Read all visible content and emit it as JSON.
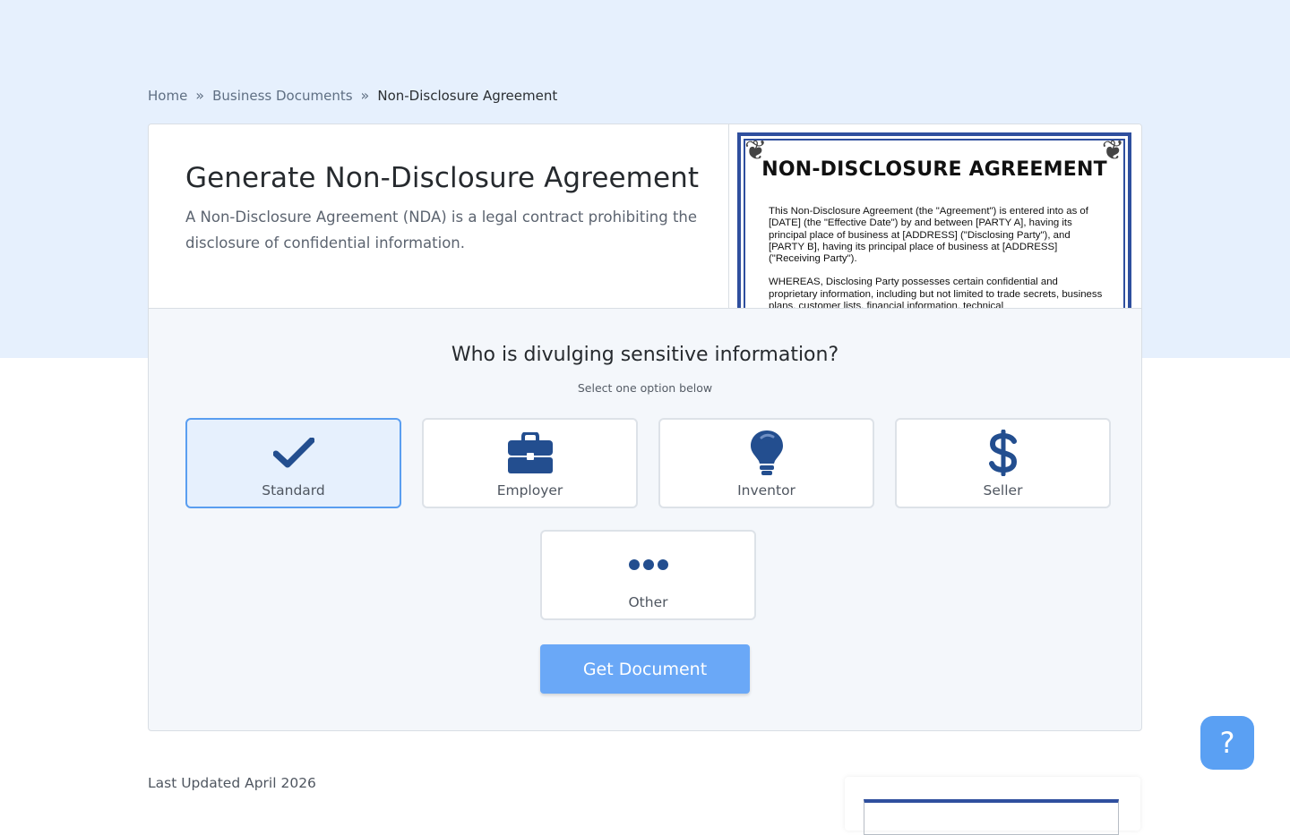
{
  "breadcrumb": {
    "items": [
      "Home",
      "Business Documents"
    ],
    "separator": "»",
    "current": "Non-Disclosure Agreement"
  },
  "intro": {
    "title": "Generate Non-Disclosure Agreement",
    "description": "A Non-Disclosure Agreement (NDA) is a legal contract prohibiting the disclosure of confidential information."
  },
  "preview": {
    "title": "NON-DISCLOSURE AGREEMENT",
    "paragraphs": [
      "This Non-Disclosure Agreement (the \"Agreement\") is entered into as of [DATE] (the \"Effective Date\") by and between [PARTY A], having its principal place of business at [ADDRESS] (\"Disclosing Party\"), and [PARTY B], having its principal place of business at [ADDRESS] (\"Receiving Party\").",
      "WHEREAS, Disclosing Party possesses certain confidential and proprietary information, including but not limited to trade secrets, business plans, customer lists, financial information, technical"
    ]
  },
  "form": {
    "question": "Who is divulging sensitive information?",
    "hint": "Select one option below",
    "options": [
      {
        "label": "Standard",
        "icon": "checkmark-icon",
        "selected": true
      },
      {
        "label": "Employer",
        "icon": "briefcase-icon",
        "selected": false
      },
      {
        "label": "Inventor",
        "icon": "lightbulb-icon",
        "selected": false
      },
      {
        "label": "Seller",
        "icon": "dollar-icon",
        "selected": false
      },
      {
        "label": "Other",
        "icon": "more-dots-icon",
        "selected": false
      }
    ],
    "submit_label": "Get Document"
  },
  "footer": {
    "updated": "Last Updated April 2026"
  },
  "help": {
    "label": "?"
  },
  "colors": {
    "accent": "#234e8f",
    "band": "#e6f0fd",
    "cta": "#6aa8f7",
    "help": "#5aa0f3",
    "selected_border": "#5a9ef0"
  }
}
